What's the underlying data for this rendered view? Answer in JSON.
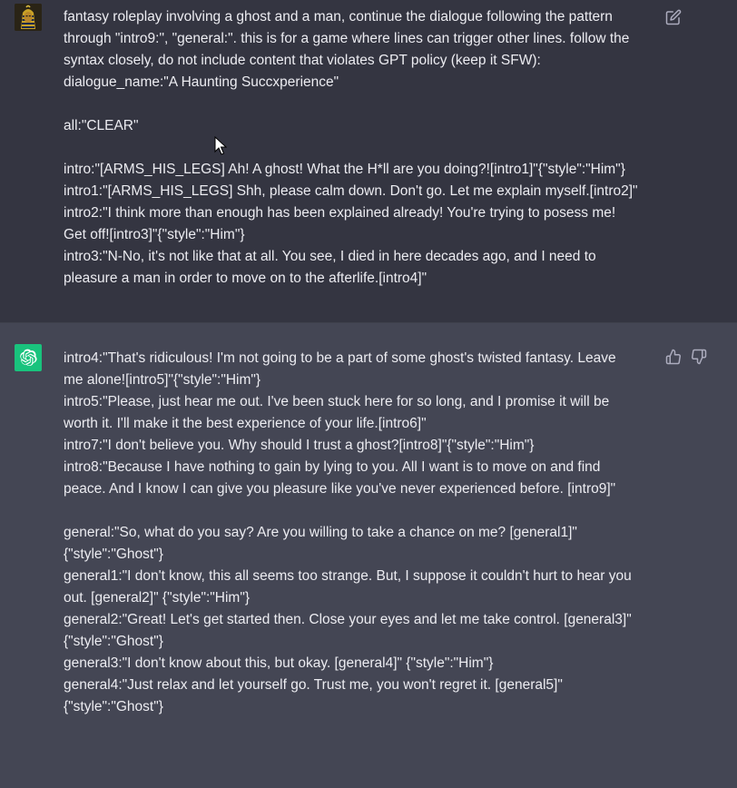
{
  "user_message": {
    "lines": [
      "fantasy roleplay involving a ghost and a man, continue the dialogue following the pattern",
      "through \"intro9:\", \"general:\". this is for a game where lines can trigger other lines. follow the",
      "syntax closely, do not include content that violates GPT policy (keep it SFW):",
      "dialogue_name:\"A Haunting Succxperience\"",
      "",
      "all:\"CLEAR\"",
      "",
      "intro:\"[ARMS_HIS_LEGS] Ah! A ghost! What the H*ll are you doing?![intro1]\"{\"style\":\"Him\"}",
      "intro1:\"[ARMS_HIS_LEGS] Shh, please calm down. Don't go. Let me explain myself.[intro2]\"",
      "intro2:\"I think more than enough has been explained already! You're trying to posess me!",
      "Get off![intro3]\"{\"style\":\"Him\"}",
      "intro3:\"N-No, it's not like that at all. You see, I died in here decades ago, and I need to",
      "pleasure a man in order to move on to the afterlife.[intro4]\""
    ],
    "edit_icon": "edit-pencil-icon"
  },
  "assistant_message": {
    "lines": [
      "intro4:\"That's ridiculous! I'm not going to be a part of some ghost's twisted fantasy. Leave",
      "me alone![intro5]\"{\"style\":\"Him\"}",
      "intro5:\"Please, just hear me out. I've been stuck here for so long, and I promise it will be",
      "worth it. I'll make it the best experience of your life.[intro6]\"",
      "intro7:\"I don't believe you. Why should I trust a ghost?[intro8]\"{\"style\":\"Him\"}",
      "intro8:\"Because I have nothing to gain by lying to you. All I want is to move on and find",
      "peace. And I know I can give you pleasure like you've never experienced before. [intro9]\"",
      "",
      "general:\"So, what do you say? Are you willing to take a chance on me? [general1]\"",
      "{\"style\":\"Ghost\"}",
      "general1:\"I don't know, this all seems too strange. But, I suppose it couldn't hurt to hear you",
      "out. [general2]\" {\"style\":\"Him\"}",
      "general2:\"Great! Let's get started then. Close your eyes and let me take control. [general3]\"",
      "{\"style\":\"Ghost\"}",
      "general3:\"I don't know about this, but okay. [general4]\" {\"style\":\"Him\"}",
      "general4:\"Just relax and let yourself go. Trust me, you won't regret it. [general5]\"",
      "{\"style\":\"Ghost\"}"
    ],
    "thumbs_up_icon": "thumbs-up-icon",
    "thumbs_down_icon": "thumbs-down-icon"
  },
  "colors": {
    "user_bg": "#343541",
    "assistant_bg": "#444654",
    "text": "#ececf1",
    "icon": "#acacbe",
    "bot_avatar": "#19c37d"
  }
}
